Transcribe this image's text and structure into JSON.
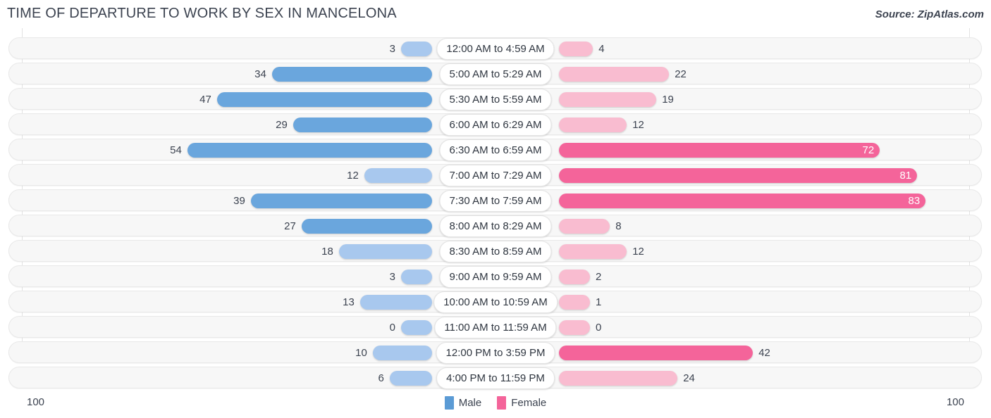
{
  "header": {
    "title": "TIME OF DEPARTURE TO WORK BY SEX IN MANCELONA",
    "source": "Source: ZipAtlas.com"
  },
  "footer": {
    "axis_max_left": "100",
    "axis_max_right": "100",
    "legend": [
      {
        "label": "Male",
        "color": "#5b9bd5"
      },
      {
        "label": "Female",
        "color": "#f4649a"
      }
    ]
  },
  "colors": {
    "male_dark": "#6aa6dd",
    "male_light": "#a8c8ee",
    "female_dark": "#f4649a",
    "female_light": "#f9bcd0",
    "track": "#f7f7f7",
    "text": "#3c4350"
  },
  "chart_data": {
    "type": "bar",
    "title": "TIME OF DEPARTURE TO WORK BY SEX IN MANCELONA",
    "subtitle": "Source: ZipAtlas.com",
    "orientation": "horizontal-diverging",
    "xlabel": "",
    "ylabel": "",
    "xlim": [
      0,
      100
    ],
    "grid": true,
    "legend_position": "bottom-center",
    "categories": [
      "12:00 AM to 4:59 AM",
      "5:00 AM to 5:29 AM",
      "5:30 AM to 5:59 AM",
      "6:00 AM to 6:29 AM",
      "6:30 AM to 6:59 AM",
      "7:00 AM to 7:29 AM",
      "7:30 AM to 7:59 AM",
      "8:00 AM to 8:29 AM",
      "8:30 AM to 8:59 AM",
      "9:00 AM to 9:59 AM",
      "10:00 AM to 10:59 AM",
      "11:00 AM to 11:59 AM",
      "12:00 PM to 3:59 PM",
      "4:00 PM to 11:59 PM"
    ],
    "series": [
      {
        "name": "Male",
        "color": "#5b9bd5",
        "values": [
          3,
          34,
          47,
          29,
          54,
          12,
          39,
          27,
          18,
          3,
          13,
          0,
          10,
          6
        ]
      },
      {
        "name": "Female",
        "color": "#f4649a",
        "values": [
          4,
          22,
          19,
          12,
          72,
          81,
          83,
          8,
          12,
          2,
          1,
          0,
          42,
          24
        ]
      }
    ]
  }
}
